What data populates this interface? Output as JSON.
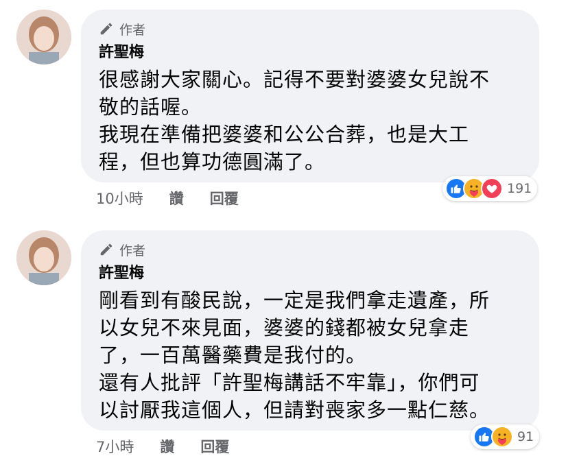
{
  "comments": [
    {
      "badge": "作者",
      "name": "許聖梅",
      "lines": [
        "很感謝大家關心。記得不要對婆婆女兒說不",
        "敬的話喔。",
        "我現在準備把婆婆和公公合葬，也是大工",
        "程，但也算功德圓滿了。"
      ],
      "time": "10小時",
      "like": "讚",
      "reply": "回覆",
      "reaction_count": "191",
      "reactions": [
        "like-icon",
        "care-icon",
        "love-icon"
      ]
    },
    {
      "badge": "作者",
      "name": "許聖梅",
      "lines": [
        "剛看到有酸民說，一定是我們拿走遺產，所",
        "以女兒不來見面，婆婆的錢都被女兒拿走",
        "了，一百萬醫藥費是我付的。",
        "還有人批評「許聖梅講話不牢靠」，你們可",
        "以討厭我這個人，但請對喪家多一點仁慈。"
      ],
      "time": "7小時",
      "like": "讚",
      "reply": "回覆",
      "reaction_count": "91",
      "reactions": [
        "like-icon",
        "care-icon"
      ]
    }
  ],
  "colors": {
    "bubble": "#f0f2f5",
    "meta": "#65676b",
    "like": "#1877f2",
    "love": "#f33e58",
    "care": "#f7b125"
  }
}
